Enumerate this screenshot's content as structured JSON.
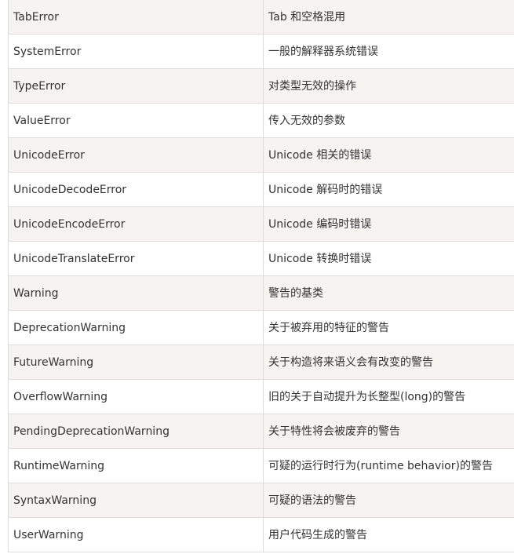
{
  "table": {
    "rows": [
      {
        "name": "TabError",
        "desc": "Tab 和空格混用"
      },
      {
        "name": "SystemError",
        "desc": "一般的解释器系统错误"
      },
      {
        "name": "TypeError",
        "desc": "对类型无效的操作"
      },
      {
        "name": "ValueError",
        "desc": "传入无效的参数"
      },
      {
        "name": "UnicodeError",
        "desc": "Unicode 相关的错误"
      },
      {
        "name": "UnicodeDecodeError",
        "desc": "Unicode 解码时的错误"
      },
      {
        "name": "UnicodeEncodeError",
        "desc": "Unicode 编码时错误"
      },
      {
        "name": "UnicodeTranslateError",
        "desc": "Unicode 转换时错误"
      },
      {
        "name": "Warning",
        "desc": "警告的基类"
      },
      {
        "name": "DeprecationWarning",
        "desc": "关于被弃用的特征的警告"
      },
      {
        "name": "FutureWarning",
        "desc": "关于构造将来语义会有改变的警告"
      },
      {
        "name": "OverflowWarning",
        "desc": "旧的关于自动提升为长整型(long)的警告"
      },
      {
        "name": "PendingDeprecationWarning",
        "desc": "关于特性将会被废弃的警告"
      },
      {
        "name": "RuntimeWarning",
        "desc": "可疑的运行时行为(runtime behavior)的警告"
      },
      {
        "name": "SyntaxWarning",
        "desc": "可疑的语法的警告"
      },
      {
        "name": "UserWarning",
        "desc": "用户代码生成的警告"
      }
    ]
  }
}
